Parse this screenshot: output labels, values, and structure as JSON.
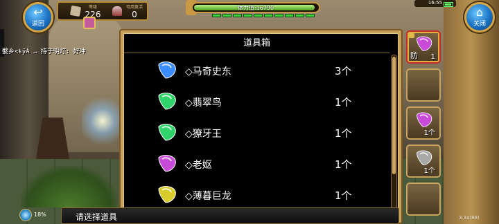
{
  "top_bar": {
    "back_label": "返回",
    "close_label": "关闭",
    "level_caption": "等级",
    "level_value": "226",
    "revive_caption": "可用复活",
    "revive_value": "0",
    "hp_text": "体力值:16790",
    "hp_fraction": 0.98,
    "stamina_segments": 10,
    "clock": "16:55"
  },
  "chat": {
    "line": "嬖乡<ŧÿĀ … 持于明灯: 好冲"
  },
  "item_box": {
    "title": "道具箱",
    "items": [
      {
        "name": "◇马奇史东",
        "quantity": "3个",
        "gem_color": "#3a8cff"
      },
      {
        "name": "◇翡翠鸟",
        "quantity": "1个",
        "gem_color": "#2fd36a"
      },
      {
        "name": "◇獠牙王",
        "quantity": "1个",
        "gem_color": "#2fd36a"
      },
      {
        "name": "◇老妪",
        "quantity": "1个",
        "gem_color": "#c84ad8"
      },
      {
        "name": "◇薄暮巨龙",
        "quantity": "1个",
        "gem_color": "#d8cc2a"
      }
    ]
  },
  "slots": [
    {
      "label": "防",
      "count": "1",
      "gem_color": "#c84ad8",
      "selected": true
    },
    {
      "label": "",
      "count": "",
      "gem_color": "",
      "selected": false
    },
    {
      "label": "",
      "count": "1个",
      "gem_color": "#c84ad8",
      "selected": false
    },
    {
      "label": "",
      "count": "1个",
      "gem_color": "#a8a8a8",
      "selected": false
    },
    {
      "label": "",
      "count": "",
      "gem_color": "",
      "selected": false
    }
  ],
  "bottom": {
    "percent": "18%",
    "prompt": "请选择道具",
    "version": "3.3a(88)"
  },
  "colors": {
    "frame_gold": "#c6a25c",
    "panel_bg": "#000000",
    "hp_green": "#4ea21e",
    "button_blue": "#1a72c4"
  }
}
